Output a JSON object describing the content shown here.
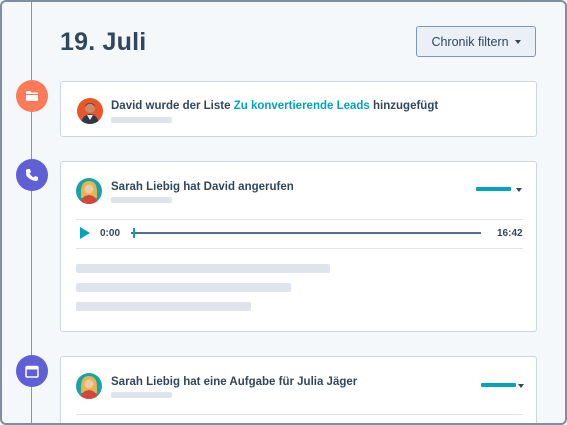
{
  "timeline": {
    "date": "19. Juli",
    "filter_button": "Chronik filtern"
  },
  "events": [
    {
      "icon": "folder-icon",
      "actor": "David",
      "text_before": "David wurde der Liste ",
      "link": "Zu konvertierende Leads",
      "text_after": " hinzugefügt"
    },
    {
      "icon": "phone-icon",
      "title": "Sarah Liebig hat David angerufen",
      "audio": {
        "current_time": "0:00",
        "duration": "16:42"
      }
    },
    {
      "icon": "calendar-icon",
      "title": "Sarah Liebig hat eine Aufgabe für Julia Jäger"
    }
  ],
  "colors": {
    "accent": "#00a4bd",
    "orange": "#ff7a59",
    "purple": "#5f5fd6",
    "text": "#33475b"
  }
}
